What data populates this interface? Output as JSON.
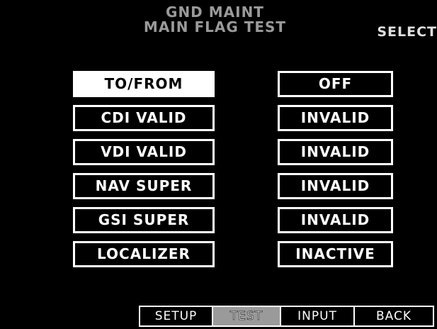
{
  "header": {
    "title_line1": "GND MAINT",
    "title_line2": "MAIN FLAG TEST",
    "select_label": "SELECT"
  },
  "flags": [
    {
      "label": "TO/FROM",
      "state": "OFF",
      "selected": true
    },
    {
      "label": "CDI VALID",
      "state": "INVALID",
      "selected": false
    },
    {
      "label": "VDI VALID",
      "state": "INVALID",
      "selected": false
    },
    {
      "label": "NAV SUPER",
      "state": "INVALID",
      "selected": false
    },
    {
      "label": "GSI SUPER",
      "state": "INVALID",
      "selected": false
    },
    {
      "label": "LOCALIZER",
      "state": "INACTIVE",
      "selected": false
    }
  ],
  "softkeys": [
    {
      "label": "SETUP",
      "active": false
    },
    {
      "label": "TEST",
      "active": true
    },
    {
      "label": "INPUT",
      "active": false
    },
    {
      "label": "BACK",
      "active": false
    }
  ],
  "colors": {
    "background": "#000000",
    "foreground": "#ffffff",
    "dim_text": "#9a9a9a",
    "active_softkey": "#9a9a9a"
  }
}
